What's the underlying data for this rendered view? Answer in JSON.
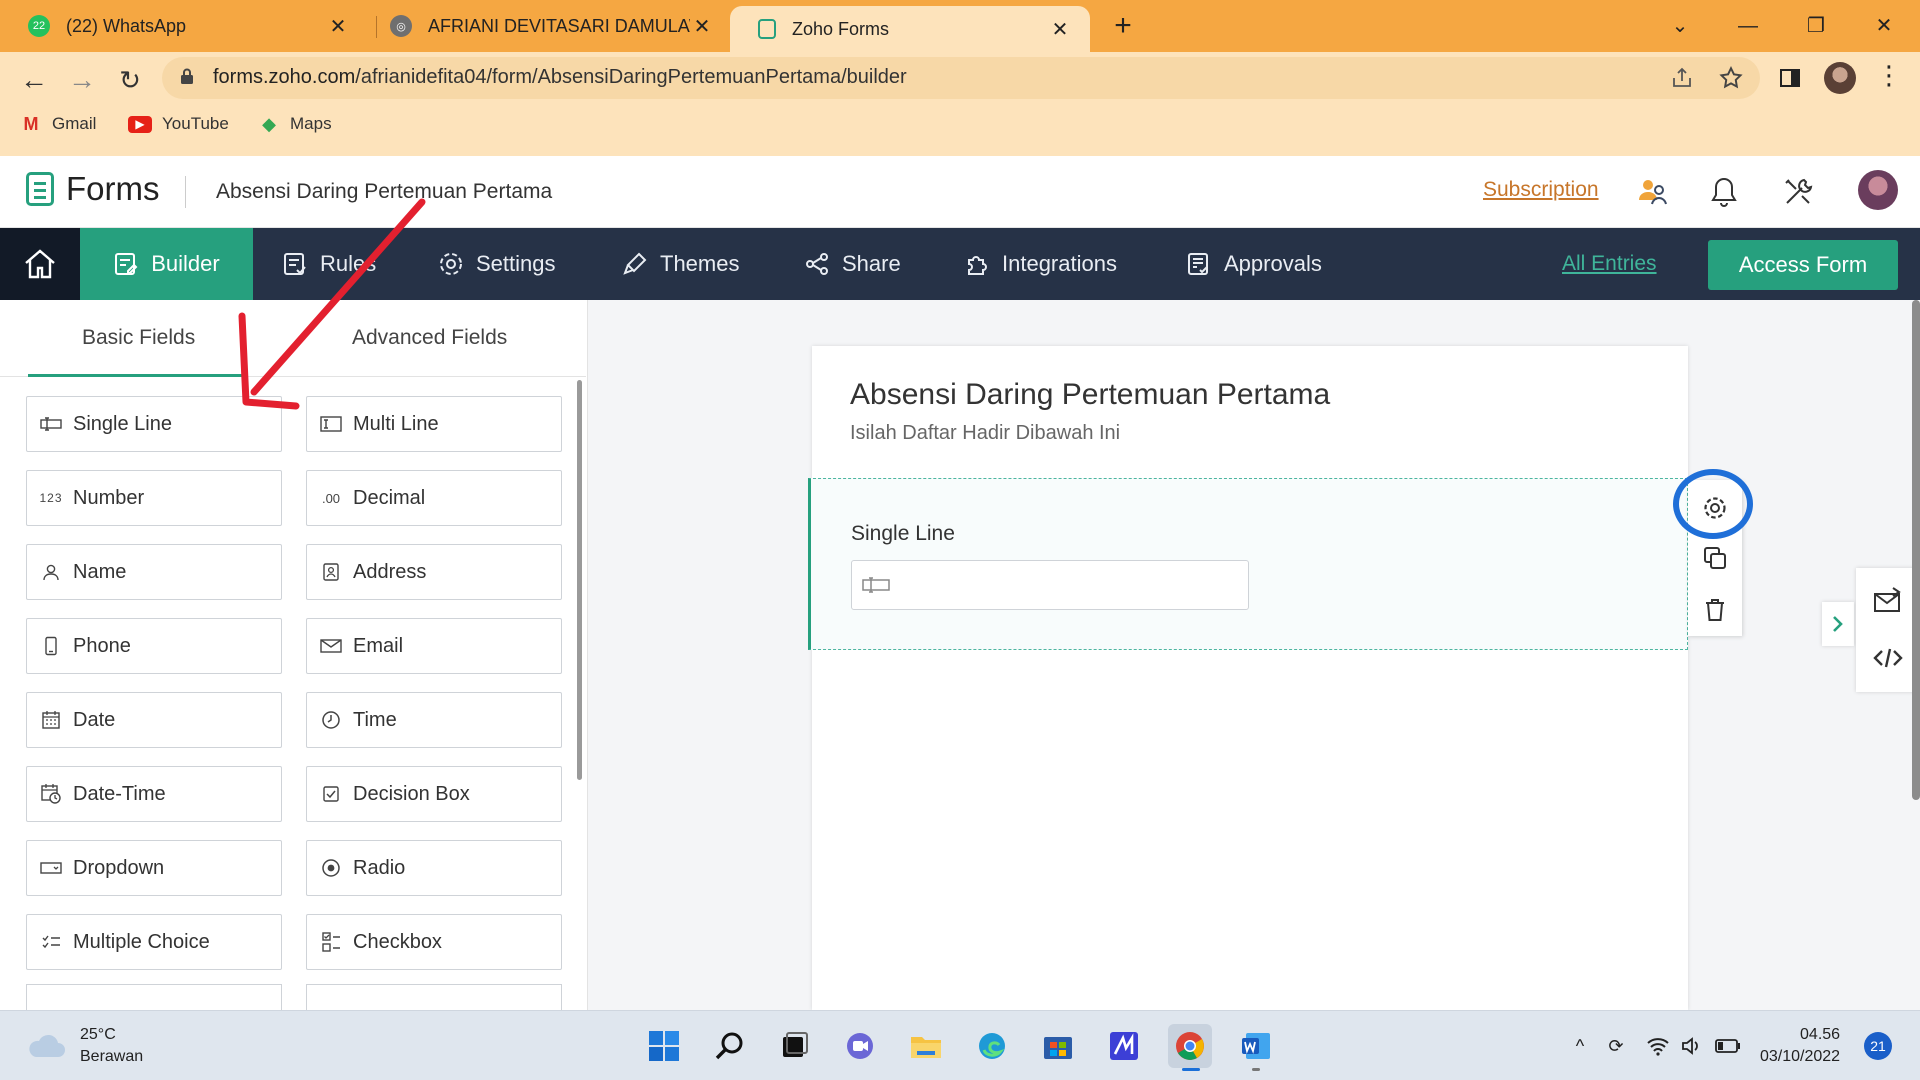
{
  "browser": {
    "tabs": [
      {
        "title": "(22) WhatsApp",
        "badge": "22",
        "active": false
      },
      {
        "title": "AFRIANI DEVITASARI DAMULAW",
        "active": false
      },
      {
        "title": "Zoho Forms",
        "active": true
      }
    ],
    "url_host": "forms.zoho.com",
    "url_path": "/afrianidefita04/form/AbsensiDaringPertemuanPertama/builder",
    "bookmarks": [
      "Gmail",
      "YouTube",
      "Maps"
    ]
  },
  "app": {
    "brand": "Forms",
    "form_name": "Absensi Daring Pertemuan Pertama",
    "subscription": "Subscription"
  },
  "nav": {
    "builder": "Builder",
    "items": [
      "Rules",
      "Settings",
      "Themes",
      "Share",
      "Integrations",
      "Approvals"
    ],
    "all_entries": "All Entries",
    "access_form": "Access Form"
  },
  "fields_panel": {
    "tabs": [
      "Basic Fields",
      "Advanced Fields"
    ],
    "active_tab": "Basic Fields",
    "fields": [
      {
        "label": "Single Line",
        "icon": "single-line-icon"
      },
      {
        "label": "Multi Line",
        "icon": "multi-line-icon"
      },
      {
        "label": "Number",
        "icon": "number-icon"
      },
      {
        "label": "Decimal",
        "icon": "decimal-icon"
      },
      {
        "label": "Name",
        "icon": "person-icon"
      },
      {
        "label": "Address",
        "icon": "address-icon"
      },
      {
        "label": "Phone",
        "icon": "phone-icon"
      },
      {
        "label": "Email",
        "icon": "envelope-icon"
      },
      {
        "label": "Date",
        "icon": "calendar-icon"
      },
      {
        "label": "Time",
        "icon": "clock-icon"
      },
      {
        "label": "Date-Time",
        "icon": "calendar-clock-icon"
      },
      {
        "label": "Decision Box",
        "icon": "checkbox-icon"
      },
      {
        "label": "Dropdown",
        "icon": "dropdown-icon"
      },
      {
        "label": "Radio",
        "icon": "radio-icon"
      },
      {
        "label": "Multiple Choice",
        "icon": "multiple-choice-icon"
      },
      {
        "label": "Checkbox",
        "icon": "checkbox-list-icon"
      }
    ]
  },
  "form": {
    "title": "Absensi Daring Pertemuan Pertama",
    "subtitle": "Isilah Daftar Hadir Dibawah Ini",
    "field_label": "Single Line"
  },
  "taskbar": {
    "temperature": "25°C",
    "weather": "Berawan",
    "time": "04.56",
    "date": "03/10/2022",
    "notifications": "21"
  },
  "colors": {
    "accent": "#26a07e",
    "nav_bg": "#263247",
    "tab_strip": "#f5a742",
    "annotation_arrow": "#e3202f",
    "annotation_circle": "#1f6fd8"
  }
}
